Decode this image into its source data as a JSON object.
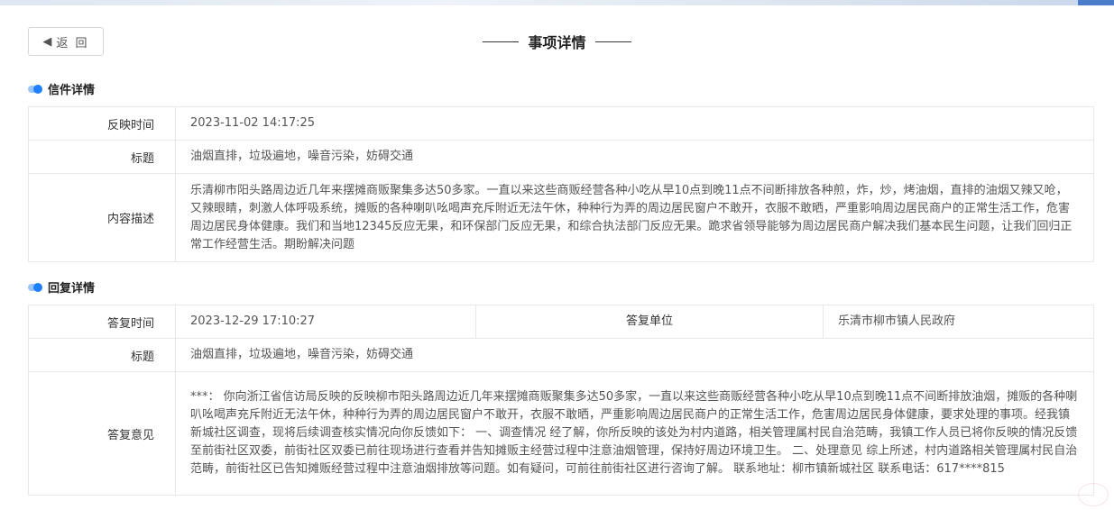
{
  "header": {
    "back_label": "返 回",
    "back_icon": "arrow-left-icon",
    "title": "事项详情"
  },
  "letter": {
    "section_title": "信件详情",
    "rows": {
      "time_label": "反映时间",
      "time_value": "2023-11-02 14:17:25",
      "title_label": "标题",
      "title_value": "油烟直排，垃圾遍地，噪音污染，妨碍交通",
      "content_label": "内容描述",
      "content_value": "乐清柳市阳头路周边近几年来摆摊商贩聚集多达50多家。一直以来这些商贩经营各种小吃从早10点到晚11点不间断排放各种煎，炸，炒，烤油烟，直排的油烟又辣又呛，又辣眼睛，刺激人体呼吸系统，摊贩的各种喇叭吆喝声充斥附近无法午休，种种行为弄的周边居民窗户不敢开，衣服不敢晒，严重影响周边居民商户的正常生活工作，危害周边居民身体健康。我们和当地12345反应无果，和环保部门反应无果，和综合执法部门反应无果。跪求省领导能够为周边居民商户解决我们基本民生问题，让我们回归正常工作经营生活。期盼解决问题"
    }
  },
  "reply": {
    "section_title": "回复详情",
    "rows": {
      "time_label": "答复时间",
      "time_value": "2023-12-29 17:10:27",
      "unit_label": "答复单位",
      "unit_value": "乐清市柳市镇人民政府",
      "title_label": "标题",
      "title_value": "油烟直排，垃圾遍地，噪音污染，妨碍交通",
      "opinion_label": "答复意见",
      "opinion_value": "***： 你向浙江省信访局反映的反映柳市阳头路周边近几年来摆摊商贩聚集多达50多家，一直以来这些商贩经营各种小吃从早10点到晚11点不间断排放油烟，摊贩的各种喇叭吆喝声充斥附近无法午休，种种行为弄的周边居民窗户不敢开，衣服不敢晒，严重影响周边居民商户的正常生活工作，危害周边居民身体健康，要求处理的事项。经我镇新城社区调查，现将后续调查核实情况向你反馈如下： 一、调查情况 经了解，你所反映的该处为村内道路，相关管理属村民自治范畴，我镇工作人员已将你反映的情况反馈至前街社区双委，前街社区双委已前往现场进行查看并告知摊贩主经营过程中注意油烟管理，保持好周边环境卫生。 二、处理意见 综上所述，村内道路相关管理属村民自治范畴，前街社区已告知摊贩经营过程中注意油烟排放等问题。如有疑问，可前往前街社区进行咨询了解。 联系地址：柳市镇新城社区 联系电话：617****815"
    }
  }
}
